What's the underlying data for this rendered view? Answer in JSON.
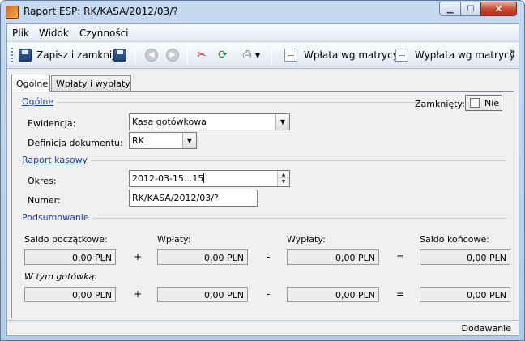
{
  "window": {
    "title": "Raport ESP: RK/KASA/2012/03/?"
  },
  "menu": {
    "items": [
      "Plik",
      "Widok",
      "Czynności"
    ]
  },
  "toolbar": {
    "save_close_label": "Zapisz i zamknij",
    "payment_in_label": "Wpłata wg matrycy",
    "payment_out_label": "Wypłata wg matrycy",
    "more": "»"
  },
  "tabs": [
    {
      "label": "Ogólne",
      "active": true
    },
    {
      "label": "Wpłaty i wypłaty",
      "active": false
    }
  ],
  "general": {
    "heading": "Ogólne",
    "closed_label": "Zamknięty:",
    "closed_value": "Nie",
    "register_label": "Ewidencja:",
    "register_value": "Kasa gotówkowa",
    "definition_label": "Definicja dokumentu:",
    "definition_value": "RK"
  },
  "report": {
    "heading": "Raport kasowy",
    "period_label": "Okres:",
    "period_value": "2012-03-15...15",
    "number_label": "Numer:",
    "number_value": "RK/KASA/2012/03/?"
  },
  "summary": {
    "heading": "Podsumowanie",
    "opening_label": "Saldo początkowe:",
    "in_label": "Wpłaty:",
    "out_label": "Wypłaty:",
    "closing_label": "Saldo końcowe:",
    "cash_label": "W tym gotówką:",
    "row1": [
      "0,00 PLN",
      "0,00 PLN",
      "0,00 PLN",
      "0,00 PLN"
    ],
    "row2": [
      "0,00 PLN",
      "0,00 PLN",
      "0,00 PLN",
      "0,00 PLN"
    ],
    "ops": [
      "+",
      "-",
      "="
    ]
  },
  "status": {
    "mode": "Dodawanie"
  }
}
